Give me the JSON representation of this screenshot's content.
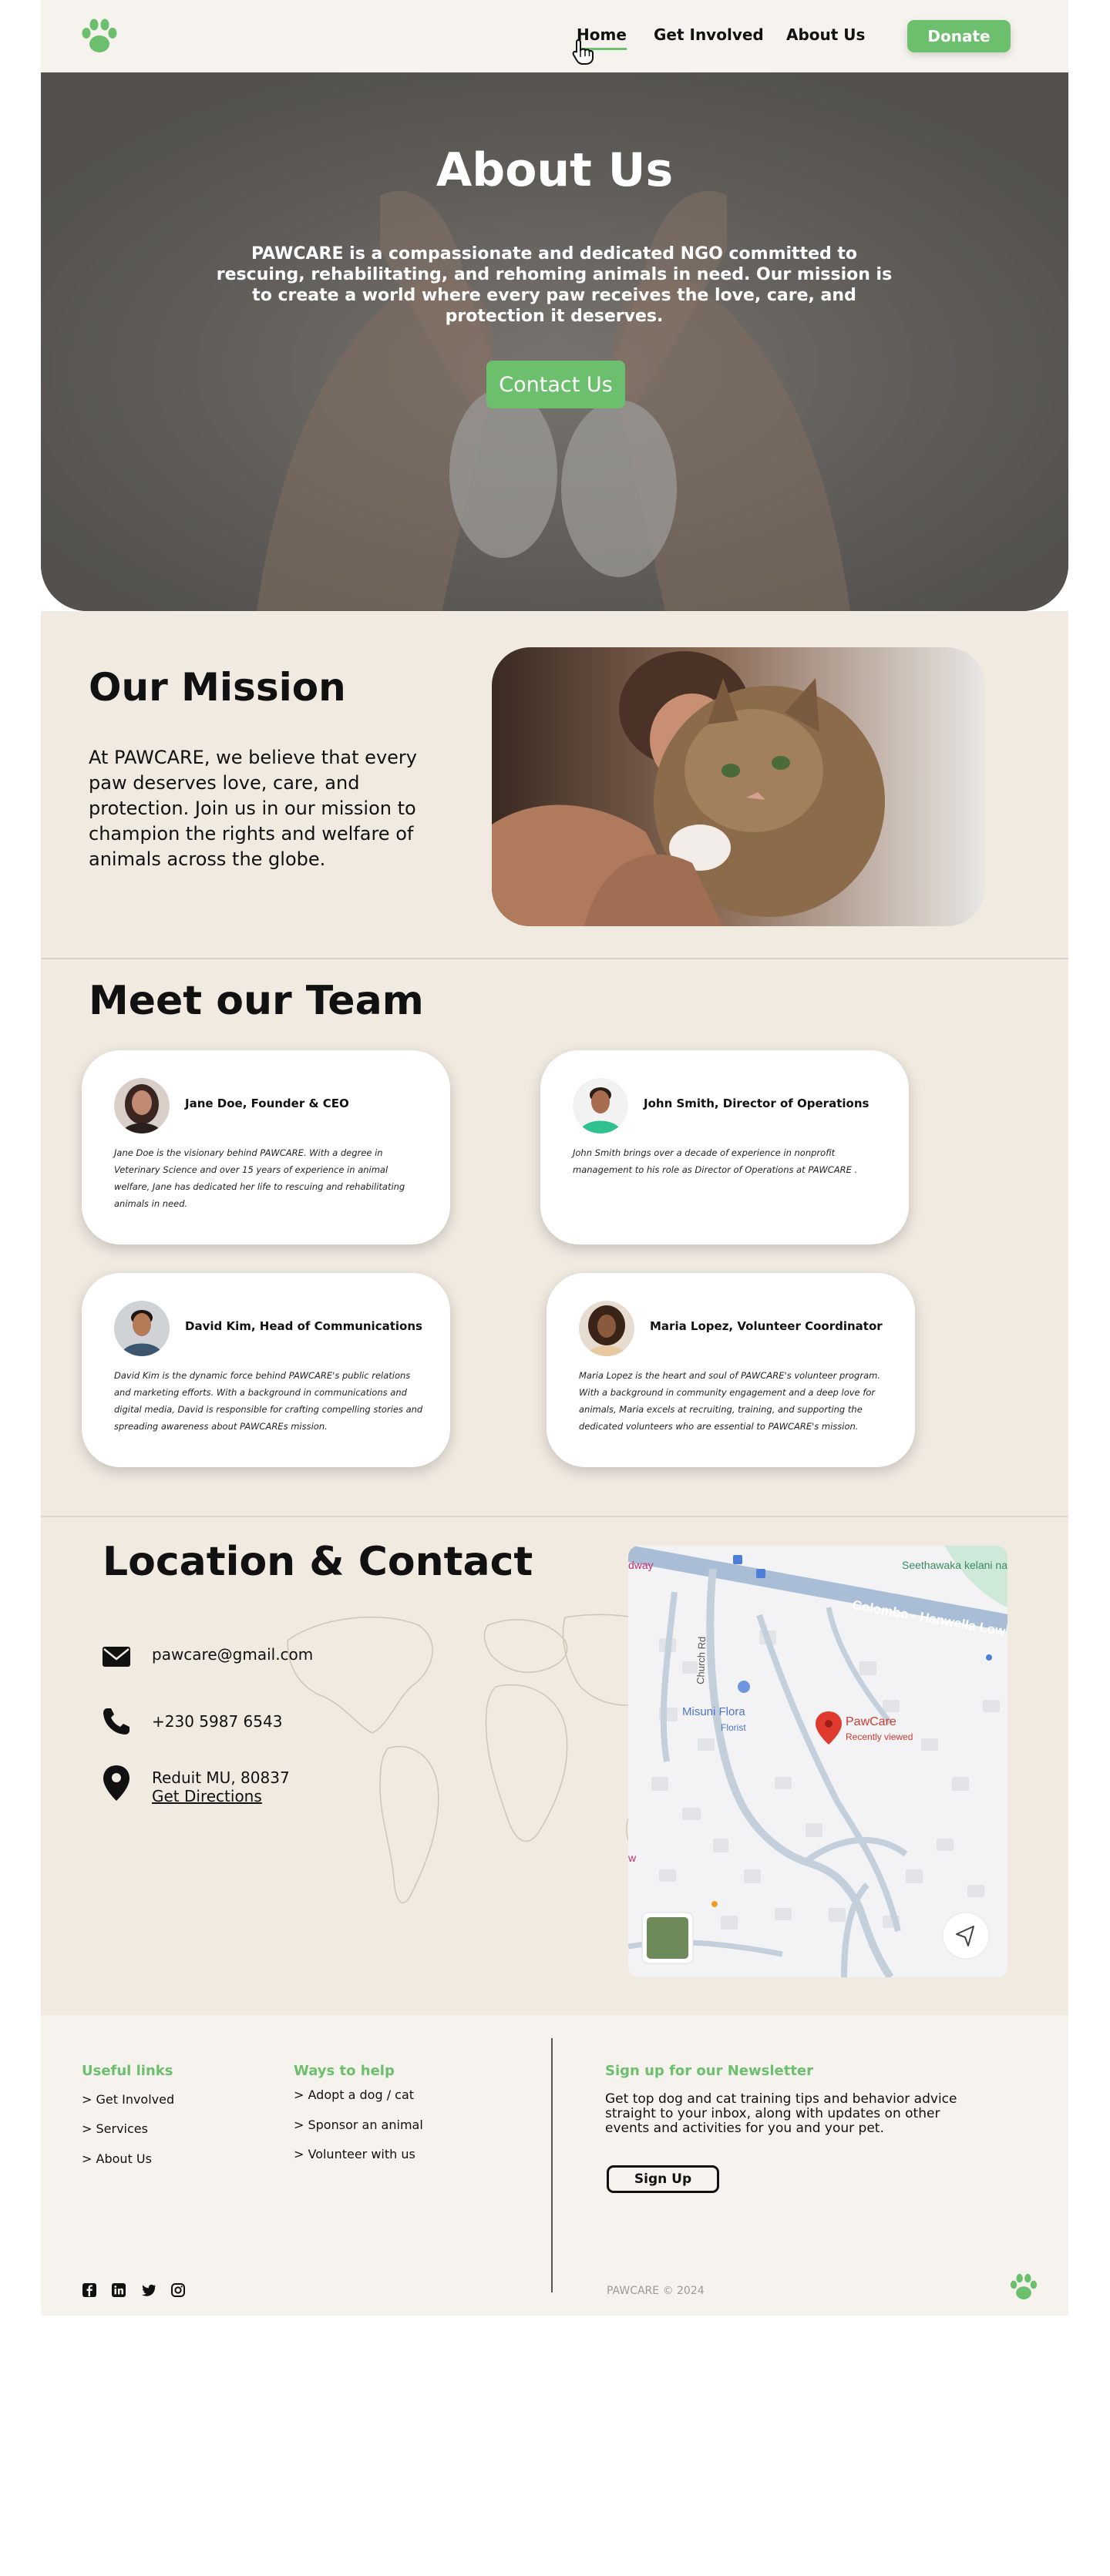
{
  "nav": {
    "items": [
      "Home",
      "Get Involved",
      "About Us"
    ],
    "donate_label": "Donate",
    "active": "Home"
  },
  "hero": {
    "title": "About Us",
    "text": "PAWCARE is a compassionate and dedicated NGO committed to rescuing, rehabilitating, and rehoming animals in need. Our mission is to create a world where every paw receives the love, care, and protection it deserves.",
    "cta_label": "Contact Us"
  },
  "mission": {
    "title": "Our Mission",
    "text": "At PAWCARE, we believe that every paw deserves love, care, and protection. Join us in our mission to champion the rights and welfare of animals across the globe."
  },
  "team": {
    "title": "Meet our Team",
    "members": [
      {
        "name": "Jane Doe, Founder & CEO",
        "bio": "Jane Doe is the visionary behind PAWCARE. With a degree in Veterinary Science and over 15 years of experience in animal welfare, Jane has dedicated her life to rescuing and rehabilitating animals in need."
      },
      {
        "name": "John Smith, Director of Operations",
        "bio": "John Smith brings over a decade of experience in nonprofit management to his role as Director of Operations at PAWCARE ."
      },
      {
        "name": "David Kim, Head of Communications",
        "bio": "David Kim is the dynamic force behind PAWCARE's public relations and marketing efforts. With a background in communications and digital media, David is responsible for crafting compelling stories and spreading awareness about PAWCAREs mission."
      },
      {
        "name": "Maria Lopez, Volunteer Coordinator",
        "bio": "Maria Lopez is the heart and soul of PAWCARE's volunteer program. With a background in community engagement and a deep love for animals, Maria excels at recruiting, training, and supporting the dedicated volunteers who are essential to PAWCARE's mission."
      }
    ]
  },
  "location": {
    "title": "Location & Contact",
    "email": "pawcare@gmail.com",
    "phone": "+230 5987 6543",
    "address": "Reduit MU, 80837",
    "directions_label": "Get Directions",
    "map": {
      "road_label": "Colombo - Hanwella Low",
      "street_label": "Church Rd",
      "park_label": "Seethawaka kelani nadee little park",
      "florist_name": "Misuni Flora",
      "florist_type": "Florist",
      "pin_name": "PawCare",
      "pin_note": "Recently viewed",
      "edge_label_1": "dway",
      "edge_label_2": "w"
    }
  },
  "footer": {
    "useful_links_title": "Useful links",
    "useful_links": [
      "> Get Involved",
      "> Services",
      "> About Us"
    ],
    "ways_title": "Ways to help",
    "ways": [
      "> Adopt a dog / cat",
      "> Sponsor an animal",
      "> Volunteer with us"
    ],
    "newsletter_title": "Sign up for our Newsletter",
    "newsletter_text": "Get top dog and cat training tips and behavior advice straight to your inbox, along with updates on other events and activities for you and your pet.",
    "signup_label": "Sign Up",
    "copyright": "PAWCARE © 2024",
    "social_icons": [
      "facebook-icon",
      "linkedin-icon",
      "twitter-icon",
      "instagram-icon"
    ]
  },
  "colors": {
    "accent": "#6cbf6c",
    "cream": "#f0eae1",
    "nav_bg": "#f6f3ee"
  }
}
